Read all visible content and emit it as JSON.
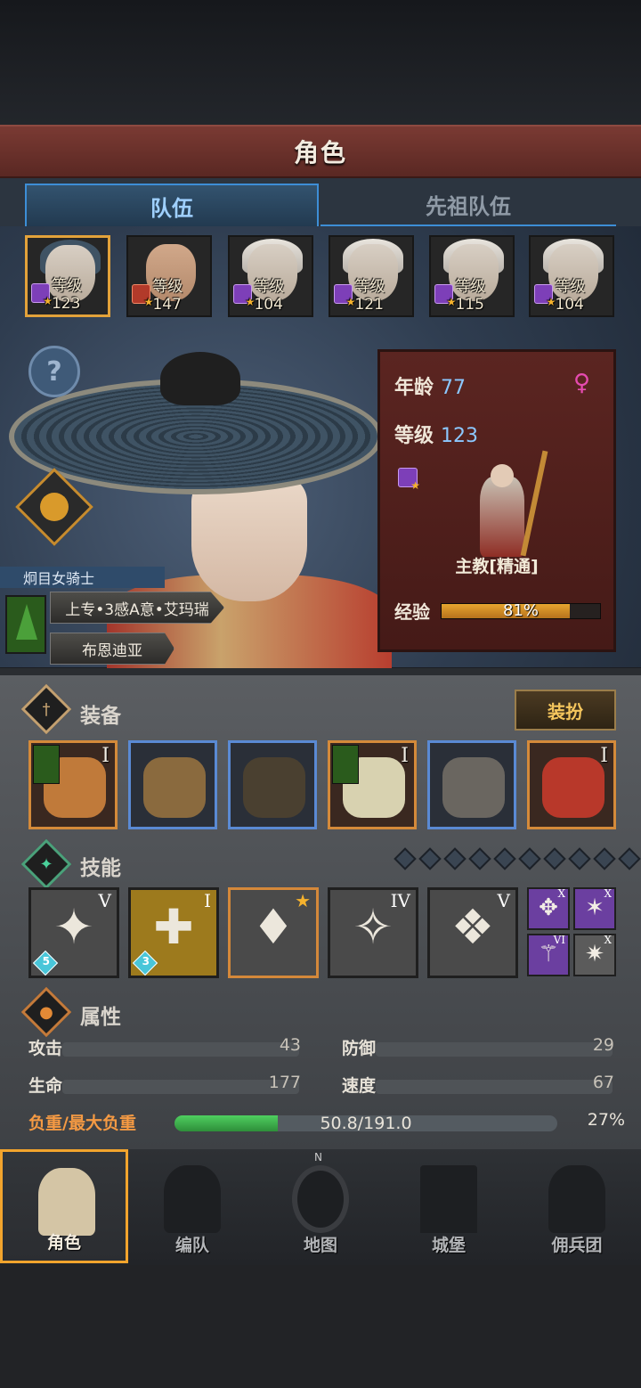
{
  "title": "角色",
  "tabs": [
    {
      "label": "队伍",
      "active": true
    },
    {
      "label": "先祖队伍",
      "active": false
    }
  ],
  "party": [
    {
      "level_label": "等级123",
      "class_icon": "staff-icon",
      "selected": true
    },
    {
      "level_label": "等级147",
      "class_icon": "fire-icon",
      "selected": false
    },
    {
      "level_label": "等级104",
      "class_icon": "staff-icon",
      "selected": false
    },
    {
      "level_label": "等级121",
      "class_icon": "staff-icon",
      "selected": false
    },
    {
      "level_label": "等级115",
      "class_icon": "staff-icon",
      "selected": false
    },
    {
      "level_label": "等级104",
      "class_icon": "staff-icon",
      "selected": false
    }
  ],
  "hero": {
    "title_name": "炯目女骑士",
    "full_name": "上专•3感A意•艾玛瑞",
    "origin": "布恩迪亚"
  },
  "info_panel": {
    "age_label": "年龄",
    "age": "77",
    "level_label": "等级",
    "level": "123",
    "class_name": "主教[精通]",
    "exp_label": "经验",
    "exp_text": "81%",
    "exp_percent": 81
  },
  "equipment": {
    "title": "装备",
    "dress_button": "装扮",
    "slots": [
      {
        "name": "amulet",
        "rank": "I",
        "rarity": "orange",
        "color": "#c07a3a",
        "has_flag": true
      },
      {
        "name": "tome",
        "rank": "",
        "rarity": "blue",
        "color": "#8a6a3e",
        "has_flag": false
      },
      {
        "name": "hood",
        "rank": "",
        "rarity": "blue",
        "color": "#4a4030",
        "has_flag": false
      },
      {
        "name": "robe",
        "rank": "I",
        "rarity": "orange",
        "color": "#d8d2b0",
        "has_flag": true
      },
      {
        "name": "boots",
        "rank": "",
        "rarity": "blue",
        "color": "#6a6660",
        "has_flag": false
      },
      {
        "name": "bat-charm",
        "rank": "I",
        "rarity": "orange",
        "color": "#b8382a",
        "has_flag": false
      }
    ]
  },
  "skills": {
    "title": "技能",
    "items": [
      {
        "rank": "V",
        "glyph": "✦",
        "gem": "5",
        "style": "grey"
      },
      {
        "rank": "I",
        "glyph": "✚",
        "gem": "3",
        "style": "gold"
      },
      {
        "rank": "★",
        "glyph": "♦",
        "gem": "",
        "style": "grey-orange"
      },
      {
        "rank": "IV",
        "glyph": "✧",
        "gem": "",
        "style": "grey"
      },
      {
        "rank": "V",
        "glyph": "❖",
        "gem": "",
        "style": "grey"
      }
    ],
    "minis": [
      {
        "rank": "X",
        "glyph": "✥",
        "style": "purple"
      },
      {
        "rank": "X",
        "glyph": "✶",
        "style": "purple"
      },
      {
        "rank": "VI",
        "glyph": "⚚",
        "style": "purple"
      },
      {
        "rank": "X",
        "glyph": "✷",
        "style": "grey"
      }
    ]
  },
  "attributes": {
    "title": "属性",
    "attack_label": "攻击",
    "attack": "43",
    "defense_label": "防御",
    "defense": "29",
    "life_label": "生命",
    "life": "177",
    "speed_label": "速度",
    "speed": "67",
    "weight_label": "负重/最大负重",
    "weight_text": "50.8/191.0",
    "weight_pct": "27%",
    "weight_fraction": 0.27
  },
  "nav": [
    {
      "label": "角色",
      "active": true
    },
    {
      "label": "编队",
      "active": false
    },
    {
      "label": "地图",
      "active": false
    },
    {
      "label": "城堡",
      "active": false
    },
    {
      "label": "佣兵团",
      "active": false
    }
  ],
  "compass_letter": "N"
}
